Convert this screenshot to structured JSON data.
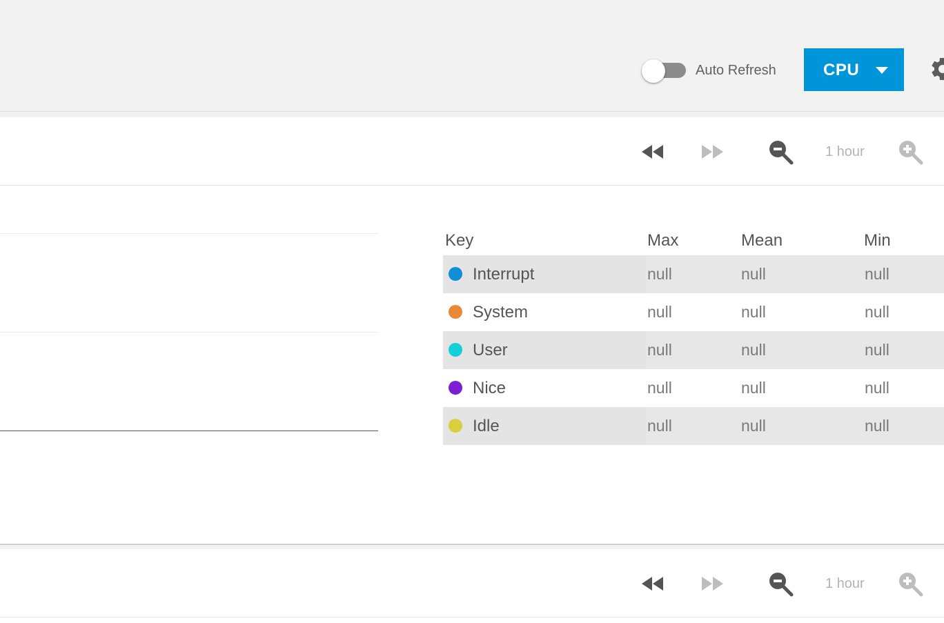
{
  "header": {
    "auto_refresh_label": "Auto Refresh",
    "auto_refresh_on": false,
    "report_selector": "CPU"
  },
  "panels": [
    {
      "range_label": "1 hour",
      "legend": {
        "headers": [
          "Key",
          "Max",
          "Mean",
          "Min"
        ],
        "rows": [
          {
            "name": "Interrupt",
            "color": "#0f8fd6",
            "max": "null",
            "mean": "null",
            "min": "null"
          },
          {
            "name": "System",
            "color": "#e88a35",
            "max": "null",
            "mean": "null",
            "min": "null"
          },
          {
            "name": "User",
            "color": "#13cfd6",
            "max": "null",
            "mean": "null",
            "min": "null"
          },
          {
            "name": "Nice",
            "color": "#7a1fd6",
            "max": "null",
            "mean": "null",
            "min": "null"
          },
          {
            "name": "Idle",
            "color": "#dccd3c",
            "max": "null",
            "mean": "null",
            "min": "null"
          }
        ]
      }
    },
    {
      "range_label": "1 hour"
    }
  ],
  "icons": {
    "gear": "gear-icon",
    "rewind": "rewind-icon",
    "fast_forward": "fast-forward-icon",
    "zoom_out": "zoom-out-icon",
    "zoom_in": "zoom-in-icon"
  }
}
